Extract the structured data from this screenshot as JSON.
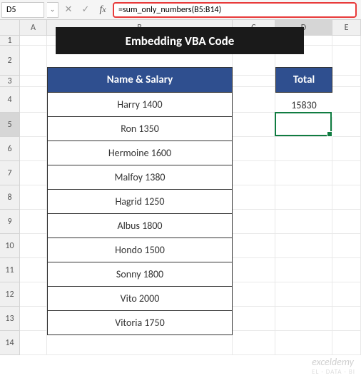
{
  "name_box": "D5",
  "formula": "=sum_only_numbers(B5:B14)",
  "columns": [
    "A",
    "B",
    "C",
    "D",
    "E"
  ],
  "row_numbers": [
    1,
    2,
    3,
    4,
    5,
    6,
    7,
    8,
    9,
    10,
    11,
    12,
    13,
    14
  ],
  "title": "Embedding VBA Code",
  "table": {
    "header": "Name & Salary",
    "rows": [
      "Harry 1400",
      "Ron 1350",
      "Hermoine 1600",
      "Malfoy 1380",
      "Hagrid 1250",
      "Albus 1800",
      "Hondo 1500",
      "Sonny 1800",
      "Vito 2000",
      "Vitoria 1750"
    ]
  },
  "total": {
    "header": "Total",
    "value": "15830"
  },
  "icons": {
    "dropdown": "⌄",
    "cancel": "✕",
    "confirm": "✓"
  },
  "watermark": {
    "main": "exceldemy",
    "sub": "EL · DATA · BI"
  },
  "colors": {
    "header_blue": "#2f4f8f",
    "title_bg": "#1a1a1a",
    "formula_border": "#e83a3a",
    "selection_green": "#107c41"
  },
  "active": {
    "row": 5,
    "col": "D"
  }
}
